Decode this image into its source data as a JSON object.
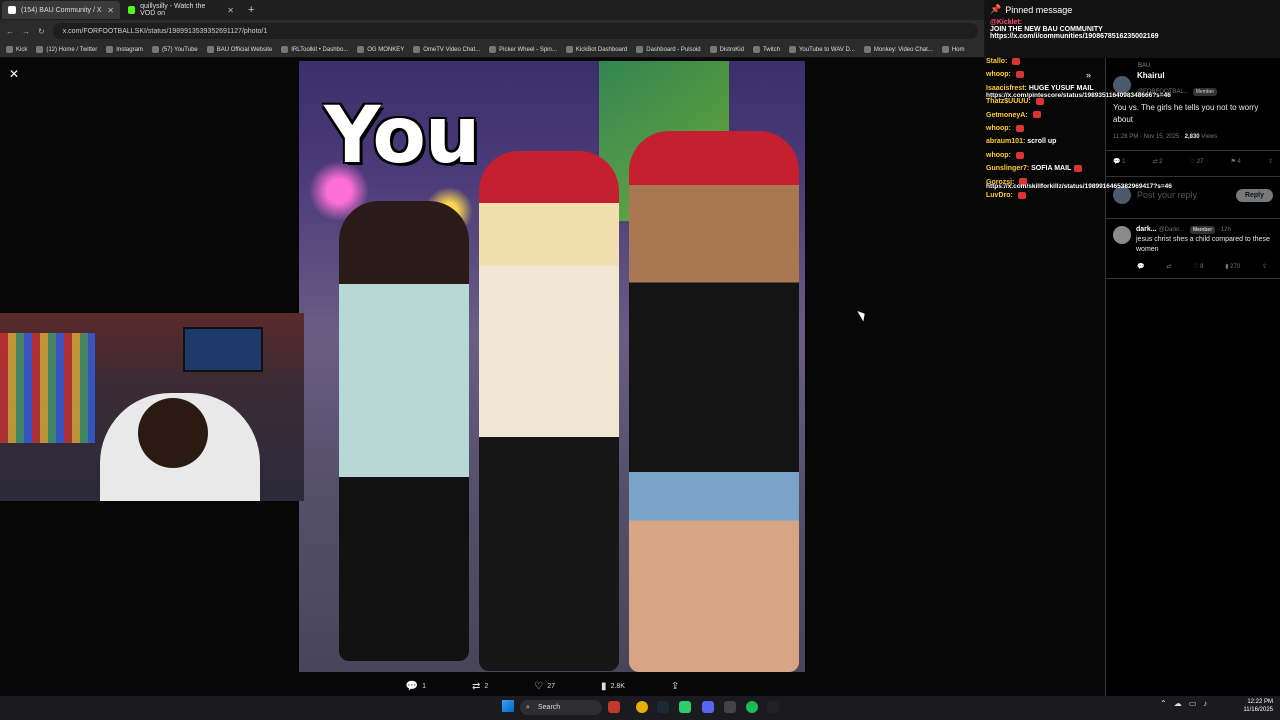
{
  "browser": {
    "tabs": [
      {
        "title": "(154) BAU Community / X",
        "active": true,
        "color": "#000000"
      },
      {
        "title": "quillysilly - Watch the VOD on",
        "active": false,
        "color": "#53fc18"
      }
    ],
    "new_tab": "+",
    "url": "x.com/FORFOOTBALLSKI/status/1989913539352691127/photo/1",
    "bookmarks": [
      "Kick",
      "(12) Home / Twitter",
      "Instagram",
      "(57) YouTube",
      "BAU Official Website",
      "IRLToolkit • Dashbo...",
      "OG MONKEY",
      "OmeTV Video Chat...",
      "Picker Wheel - Spin...",
      "KickBot Dashboard",
      "Dashboard - Pulsoid",
      "DistroKid",
      "Twitch",
      "YouTube to WAV D...",
      "Monkey: Video Chat...",
      "Hom"
    ]
  },
  "viewer": {
    "caption": "You",
    "actions": {
      "replies": "1",
      "reposts": "2",
      "likes": "27",
      "views": "2.8K"
    }
  },
  "pinned": {
    "title": "Pinned message",
    "user": "@Kicklet:",
    "line1": "JOIN THE NEW BAU COMMUNITY",
    "line2": "https://x.com/i/communities/1908678516235002169"
  },
  "chat": [
    {
      "user": "Stallo:",
      "msg": "",
      "emote": true
    },
    {
      "user": "whoop:",
      "msg": "",
      "emote": true
    },
    {
      "user": "Isaacisfrest:",
      "msg": "HUGE YUSUF MAIL",
      "emote": false
    },
    {
      "user": "",
      "msg": "",
      "emote": false
    },
    {
      "user": "Thatz$UUUU:",
      "msg": "",
      "emote": true
    },
    {
      "user": "GetmoneyA:",
      "msg": "",
      "emote": true
    },
    {
      "user": "whoop:",
      "msg": "",
      "emote": true
    },
    {
      "user": "abraum101:",
      "msg": "scroll up",
      "emote": false
    },
    {
      "user": "whoop:",
      "msg": "",
      "emote": true
    },
    {
      "user": "Gunslinger7:",
      "msg": "SOFIA MAIL",
      "emote": true
    },
    {
      "user": "",
      "msg": "",
      "emote": false
    },
    {
      "user": "Gorozsj:",
      "msg": "",
      "emote": true
    },
    {
      "user": "LuvDro:",
      "msg": "",
      "emote": true
    }
  ],
  "chat_links": [
    "https://x.com/pintescore/status/1989351164098348666?s=46",
    "https://x.com/skillforkillz/status/1989916465382969417?s=46"
  ],
  "tweet": {
    "community": "BAU",
    "author": "Khairul",
    "handle": "@FORFOOTBAL...",
    "badge": "Member",
    "text": "You vs. The girls he tells you not to worry about",
    "time": "11:28 PM · Nov 15, 2025 ·",
    "views": "2,830",
    "views_label": "Views",
    "actions": {
      "replies": "1",
      "reposts": "2",
      "likes": "27",
      "bookmarks": "4"
    }
  },
  "reply": {
    "placeholder": "Post your reply",
    "button": "Reply"
  },
  "comment": {
    "author": "dark...",
    "handle": "@Darkr...",
    "badge": "Member",
    "time": "· 12h",
    "text": "jesus christ shes a child compared to these women",
    "actions": {
      "likes": "8",
      "views": "270"
    }
  },
  "taskbar": {
    "search": "Search",
    "time": "12:22 PM",
    "date": "11/16/2025"
  }
}
